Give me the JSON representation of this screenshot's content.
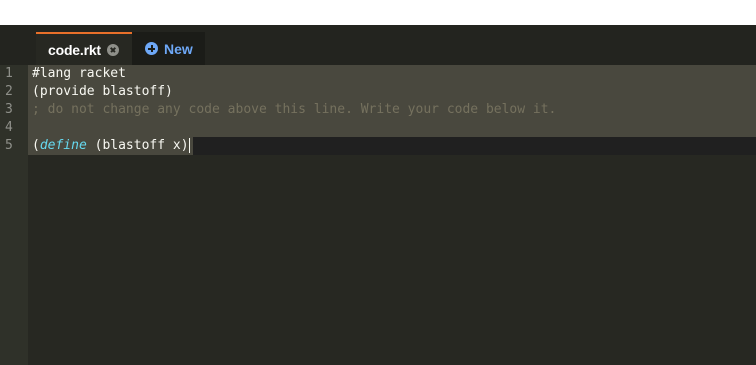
{
  "tabs": {
    "file_label": "code.rkt",
    "new_label": "New"
  },
  "gutter": {
    "line_numbers": [
      "1",
      "2",
      "3",
      "4",
      "5"
    ]
  },
  "code": {
    "line1": "#lang racket",
    "line2": "(provide blastoff)",
    "line3": "; do not change any code above this line. Write your code below it.",
    "line4": "",
    "line5_open": "(",
    "line5_keyword": "define",
    "line5_rest": " (blastoff x)"
  },
  "colors": {
    "background": "#272822",
    "gutter": "#2f3129",
    "selection": "#49483e",
    "comment": "#75715e",
    "keyword": "#66d9ef",
    "tab_accent": "#e9702a",
    "new_tab_text": "#6ea8f7"
  },
  "icons": {
    "tab_close": "close-icon",
    "new_tab": "plus-icon"
  }
}
